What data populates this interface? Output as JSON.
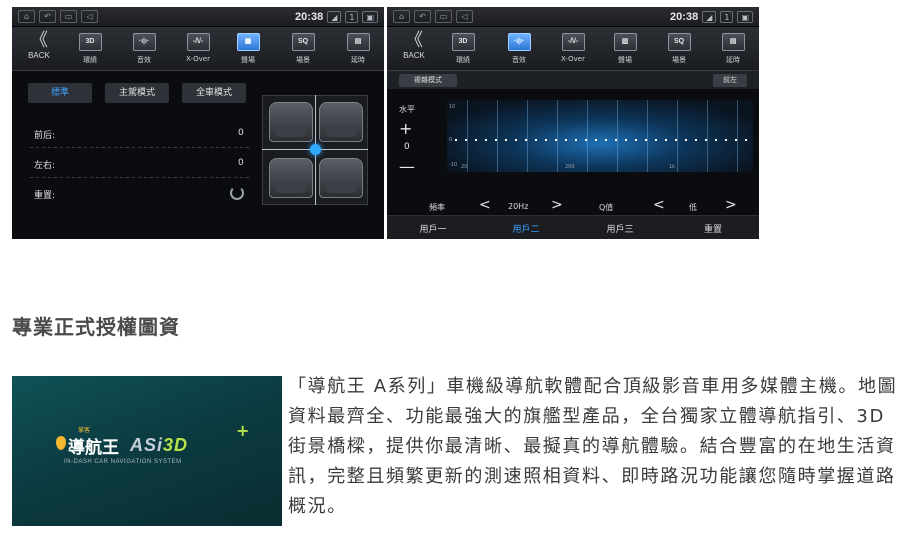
{
  "screens": [
    {
      "status": {
        "time": "20:38",
        "indicator": "1"
      },
      "toolbar": {
        "back_label": "BACK",
        "items": [
          {
            "icon_text": "3D",
            "label": "環繞"
          },
          {
            "icon_text": "·ı|ı·",
            "label": "音效"
          },
          {
            "icon_text": "-/\\/-",
            "label": "X-Over"
          },
          {
            "icon_text": "▦",
            "label": "聲場"
          },
          {
            "icon_text": "SQ",
            "label": "場景"
          },
          {
            "icon_text": "▤",
            "label": "延時"
          }
        ],
        "active_index": 3
      },
      "modes": [
        "標準",
        "主駕模式",
        "全車模式"
      ],
      "active_mode": 0,
      "rows": [
        {
          "label": "前后:",
          "value": "0"
        },
        {
          "label": "左右:",
          "value": "0"
        },
        {
          "label": "重置:",
          "value": ""
        }
      ]
    },
    {
      "status": {
        "time": "20:38",
        "indicator": "1"
      },
      "toolbar": {
        "back_label": "BACK",
        "items": [
          {
            "icon_text": "3D",
            "label": "環繞"
          },
          {
            "icon_text": "·ı|ı·",
            "label": "音效"
          },
          {
            "icon_text": "-/\\/-",
            "label": "X-Over"
          },
          {
            "icon_text": "▥",
            "label": "聲場"
          },
          {
            "icon_text": "SQ",
            "label": "場景"
          },
          {
            "icon_text": "▤",
            "label": "延時"
          }
        ],
        "active_index": 1
      },
      "sub_left": "複雜模式",
      "sub_right": "前左",
      "side_label": "水平",
      "plus": "+",
      "zero": "0",
      "minus": "—",
      "graph": {
        "ymax": "10",
        "ymid": "0",
        "ymin": "-10",
        "x_ticks": [
          "20",
          "200",
          "1k"
        ]
      },
      "controls": {
        "freq_label": "頻率",
        "freq_value": "20Hz",
        "q_label": "Q值",
        "q_value": "低",
        "left_arrow": "<",
        "right_arrow": ">"
      },
      "users": [
        "用戶一",
        "用戶二",
        "用戶三",
        "重置"
      ],
      "active_user": 1
    }
  ],
  "article": {
    "heading": "專業正式授權圖資",
    "banner": {
      "brand_small": "掌客",
      "brand_cn": "導航王",
      "brand_en_a": "ASi",
      "brand_en_b": "3D",
      "plus": "+",
      "subtitle": "IN-DASH CAR NAVIGATION SYSTEM"
    },
    "paragraph": "「導航王 A系列」車機級導航軟體配合頂級影音車用多媒體主機。地圖資料最齊全、功能最強大的旗艦型產品，全台獨家立體導航指引、3D街景橋樑，提供你最清晰、最擬真的導航體驗。結合豐富的在地生活資訊，完整且頻繁更新的測速照相資料、即時路況功能讓您隨時掌握道路概況。"
  }
}
